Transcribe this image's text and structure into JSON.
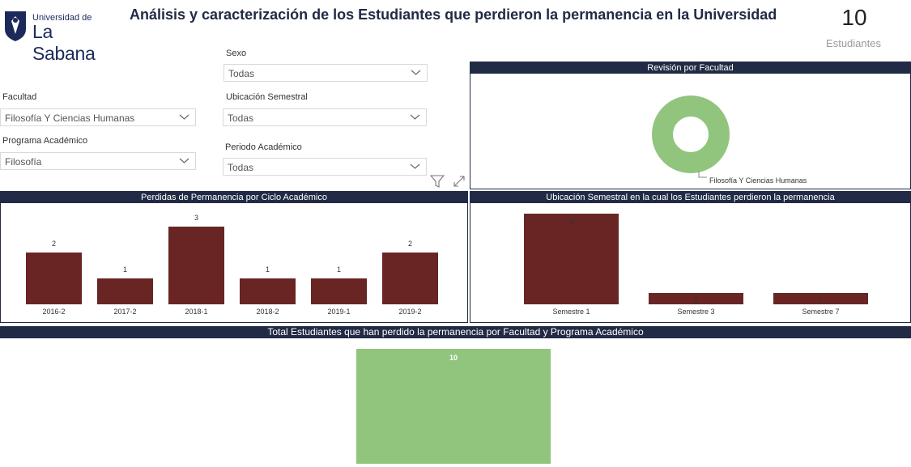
{
  "header": {
    "logo_line1": "Universidad de",
    "logo_line2": "La Sabana",
    "title": "Análisis y caracterización de los Estudiantes que perdieron la permanencia en la Universidad",
    "kpi_value": "10",
    "kpi_label": "Estudiantes"
  },
  "filters": {
    "sexo": {
      "label": "Sexo",
      "value": "Todas"
    },
    "facultad": {
      "label": "Facultad",
      "value": "Filosofía Y Ciencias Humanas"
    },
    "ubicacion": {
      "label": "Ubicación Semestral",
      "value": "Todas"
    },
    "programa": {
      "label": "Programa Académico",
      "value": "Filosofía"
    },
    "periodo": {
      "label": "Periodo Académico",
      "value": "Todas"
    }
  },
  "icons": {
    "filter": "filter-icon",
    "expand": "focus-mode-icon",
    "chevron": "chevron-down-icon",
    "logo": "university-shield-logo"
  },
  "colors": {
    "bar": "#692424",
    "donut": "#91c57e",
    "header_band": "#222b45",
    "treemap": "#91c57e"
  },
  "chart_data": [
    {
      "type": "pie",
      "title": "Revisión por Facultad",
      "categories": [
        "Filosofía Y Ciencias Humanas"
      ],
      "values": [
        10
      ],
      "legend": "Filosofía Y Ciencias Humanas"
    },
    {
      "type": "bar",
      "title": "Perdidas de Permanencia por Ciclo Académico",
      "categories": [
        "2016-2",
        "2017-2",
        "2018-1",
        "2018-2",
        "2019-1",
        "2019-2"
      ],
      "values": [
        2,
        1,
        3,
        1,
        1,
        2
      ],
      "ylim": [
        0,
        3
      ]
    },
    {
      "type": "bar",
      "title": "Ubicación Semestral en la cual los Estudiantes perdieron la permanencia",
      "categories": [
        "Semestre 1",
        "Semestre 3",
        "Semestre 7"
      ],
      "values": [
        8,
        1,
        1
      ],
      "ylim": [
        0,
        8
      ]
    },
    {
      "type": "heatmap",
      "title": "Total Estudiantes que han perdido la permanencia por Facultad y Programa Académico",
      "values": [
        10
      ]
    }
  ]
}
